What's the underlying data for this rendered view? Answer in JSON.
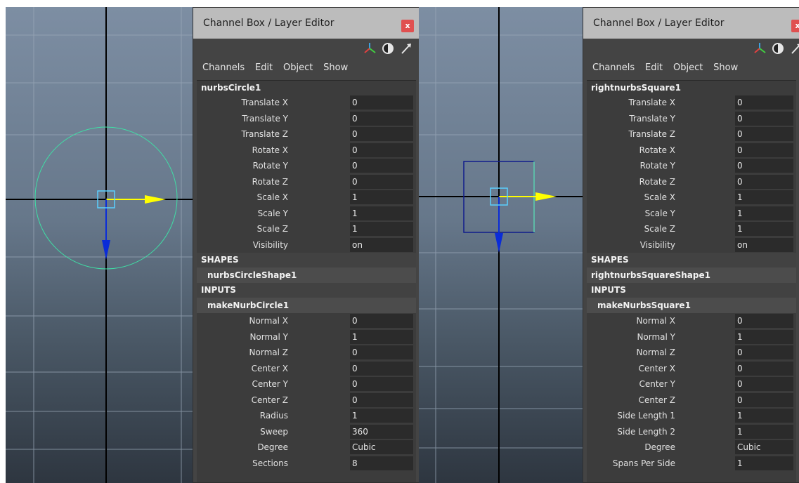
{
  "left": {
    "panel_title": "Channel Box / Layer Editor",
    "close_label": "x",
    "menu": [
      "Channels",
      "Edit",
      "Object",
      "Show"
    ],
    "object_name": "nurbsCircle1",
    "channels": [
      {
        "label": "Translate X",
        "value": "0"
      },
      {
        "label": "Translate Y",
        "value": "0"
      },
      {
        "label": "Translate Z",
        "value": "0"
      },
      {
        "label": "Rotate X",
        "value": "0"
      },
      {
        "label": "Rotate Y",
        "value": "0"
      },
      {
        "label": "Rotate Z",
        "value": "0"
      },
      {
        "label": "Scale X",
        "value": "1"
      },
      {
        "label": "Scale Y",
        "value": "1"
      },
      {
        "label": "Scale Z",
        "value": "1"
      },
      {
        "label": "Visibility",
        "value": "on"
      }
    ],
    "shapes_label": "SHAPES",
    "shape_name": "nurbsCircleShape1",
    "inputs_label": "INPUTS",
    "input_name": "makeNurbCircle1",
    "input_channels": [
      {
        "label": "Normal X",
        "value": "0"
      },
      {
        "label": "Normal Y",
        "value": "1"
      },
      {
        "label": "Normal Z",
        "value": "0"
      },
      {
        "label": "Center X",
        "value": "0"
      },
      {
        "label": "Center Y",
        "value": "0"
      },
      {
        "label": "Center Z",
        "value": "0"
      },
      {
        "label": "Radius",
        "value": "1"
      },
      {
        "label": "Sweep",
        "value": "360"
      },
      {
        "label": "Degree",
        "value": "Cubic"
      },
      {
        "label": "Sections",
        "value": "8"
      }
    ]
  },
  "right": {
    "panel_title": "Channel Box / Layer Editor",
    "close_label": "x",
    "menu": [
      "Channels",
      "Edit",
      "Object",
      "Show"
    ],
    "object_name": "rightnurbsSquare1",
    "channels": [
      {
        "label": "Translate X",
        "value": "0"
      },
      {
        "label": "Translate Y",
        "value": "0"
      },
      {
        "label": "Translate Z",
        "value": "0"
      },
      {
        "label": "Rotate X",
        "value": "0"
      },
      {
        "label": "Rotate Y",
        "value": "0"
      },
      {
        "label": "Rotate Z",
        "value": "0"
      },
      {
        "label": "Scale X",
        "value": "1"
      },
      {
        "label": "Scale Y",
        "value": "1"
      },
      {
        "label": "Scale Z",
        "value": "1"
      },
      {
        "label": "Visibility",
        "value": "on"
      }
    ],
    "shapes_label": "SHAPES",
    "shape_name": "rightnurbsSquareShape1",
    "inputs_label": "INPUTS",
    "input_name": "makeNurbsSquare1",
    "input_channels": [
      {
        "label": "Normal X",
        "value": "0"
      },
      {
        "label": "Normal Y",
        "value": "1"
      },
      {
        "label": "Normal Z",
        "value": "0"
      },
      {
        "label": "Center X",
        "value": "0"
      },
      {
        "label": "Center Y",
        "value": "0"
      },
      {
        "label": "Center Z",
        "value": "0"
      },
      {
        "label": "Side Length 1",
        "value": "1"
      },
      {
        "label": "Side Length 2",
        "value": "1"
      },
      {
        "label": "Degree",
        "value": "Cubic"
      },
      {
        "label": "Spans Per Side",
        "value": "1"
      }
    ]
  },
  "colors": {
    "circle_curve": "#3fe0a6",
    "square_curve": "#101c8c",
    "square_selected_edge": "#6ae0b0",
    "manipulator_x": "#ffff00",
    "manipulator_y": "#0a2cd8",
    "manipulator_center": "#5ad0ff",
    "close_button": "#e05050"
  },
  "icons": [
    "move-tool-icon",
    "render-sphere-icon",
    "arrow-icon"
  ]
}
